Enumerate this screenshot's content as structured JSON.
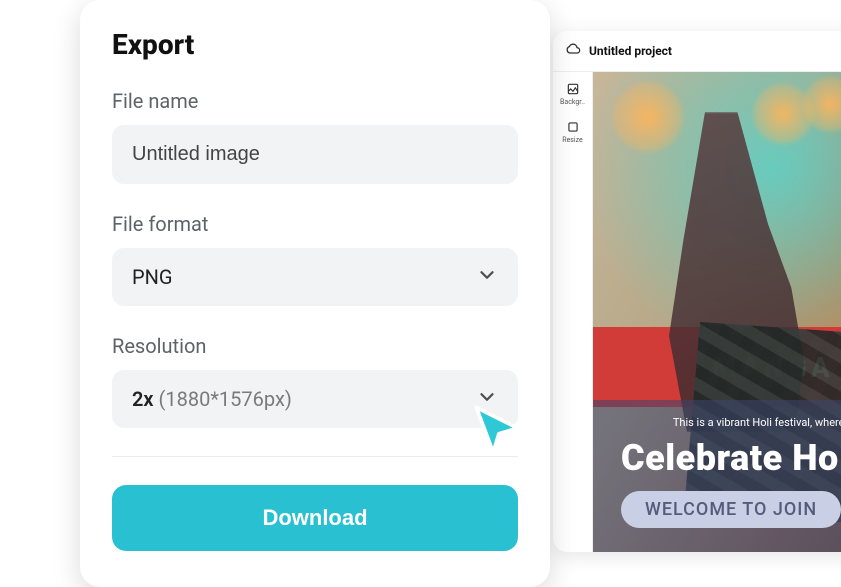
{
  "export": {
    "title": "Export",
    "file_name_label": "File name",
    "file_name_value": "Untitled image",
    "file_format_label": "File format",
    "file_format_value": "PNG",
    "resolution_label": "Resolution",
    "resolution_multiplier": "2x",
    "resolution_dims": "(1880*1576px)",
    "download_label": "Download"
  },
  "editor": {
    "project_name": "Untitled project",
    "tools": {
      "background_label": "Backgr..",
      "resize_label": "Resize"
    }
  },
  "canvas": {
    "banner_text": "MANGA",
    "overlay_sub": "This is a vibrant Holi festival, where you c",
    "overlay_title": "Celebrate Ho",
    "pill_label": "WELCOME TO JOIN"
  }
}
